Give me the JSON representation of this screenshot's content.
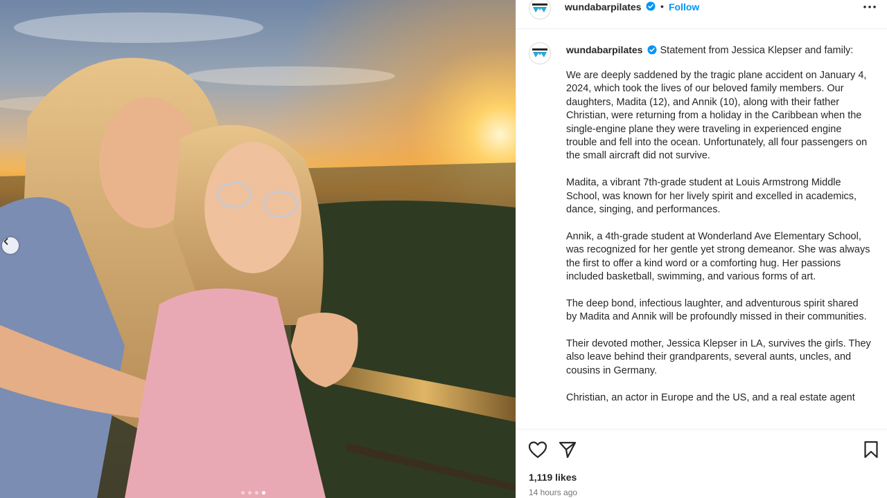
{
  "colors": {
    "accent_blue": "#0095f6",
    "text_primary": "#262626",
    "text_secondary": "#737373",
    "border": "#efefef",
    "brand_logo": "#2aa6d9"
  },
  "media": {
    "slide_count": 4,
    "active_slide_index": 3,
    "prev_icon": "chevron-left-icon"
  },
  "header": {
    "username": "wundabarpilates",
    "verified_icon": "verified-badge-icon",
    "separator": "•",
    "follow_label": "Follow",
    "more_icon": "more-options-icon"
  },
  "caption": {
    "username": "wundabarpilates",
    "headline": "Statement from Jessica Klepser and family:",
    "paragraphs": [
      "We are deeply saddened by the tragic plane accident on January 4, 2024, which took the lives of our beloved family members. Our daughters, Madita (12), and Annik (10), along with their father Christian, were returning from a holiday in the Caribbean when the single-engine plane they were traveling in experienced engine trouble and fell into the ocean. Unfortunately, all four passengers on the small aircraft did not survive.",
      "Madita, a vibrant 7th-grade student at Louis Armstrong Middle School, was known for her lively spirit and excelled in academics, dance, singing, and performances.",
      "Annik, a 4th-grade student at Wonderland Ave Elementary School, was recognized for her gentle yet strong demeanor. She was always the first to offer a kind word or a comforting hug. Her passions included basketball, swimming, and various forms of art.",
      "The deep bond, infectious laughter, and adventurous spirit shared by Madita and Annik will be profoundly missed in their communities.",
      "Their devoted mother, Jessica Klepser in LA, survives the girls. They also leave behind their grandparents, several aunts, uncles, and cousins in Germany.",
      "Christian, an actor in Europe and the US, and a real estate agent"
    ]
  },
  "actions": {
    "like_icon": "heart-icon",
    "share_icon": "send-icon",
    "save_icon": "bookmark-icon",
    "likes_text": "1,119 likes",
    "timestamp": "14 hours ago"
  }
}
